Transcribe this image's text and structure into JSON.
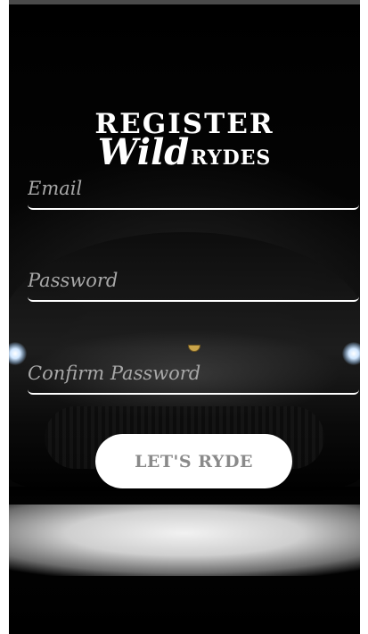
{
  "logo": {
    "title": "REGISTER",
    "wild": "Wild",
    "rydes": "RYDES"
  },
  "form": {
    "email": {
      "placeholder": "Email",
      "value": ""
    },
    "password": {
      "placeholder": "Password",
      "value": ""
    },
    "confirm_password": {
      "placeholder": "Confirm Password",
      "value": ""
    },
    "submit_label": "LET'S RYDE"
  },
  "colors": {
    "background": "#000000",
    "field_line": "#ffffff",
    "placeholder": "#a8a8a8",
    "button_bg": "#ffffff",
    "button_text": "#8a8a8a"
  },
  "icons": [
    "headlight-left",
    "headlight-right",
    "car-emblem-icon"
  ]
}
